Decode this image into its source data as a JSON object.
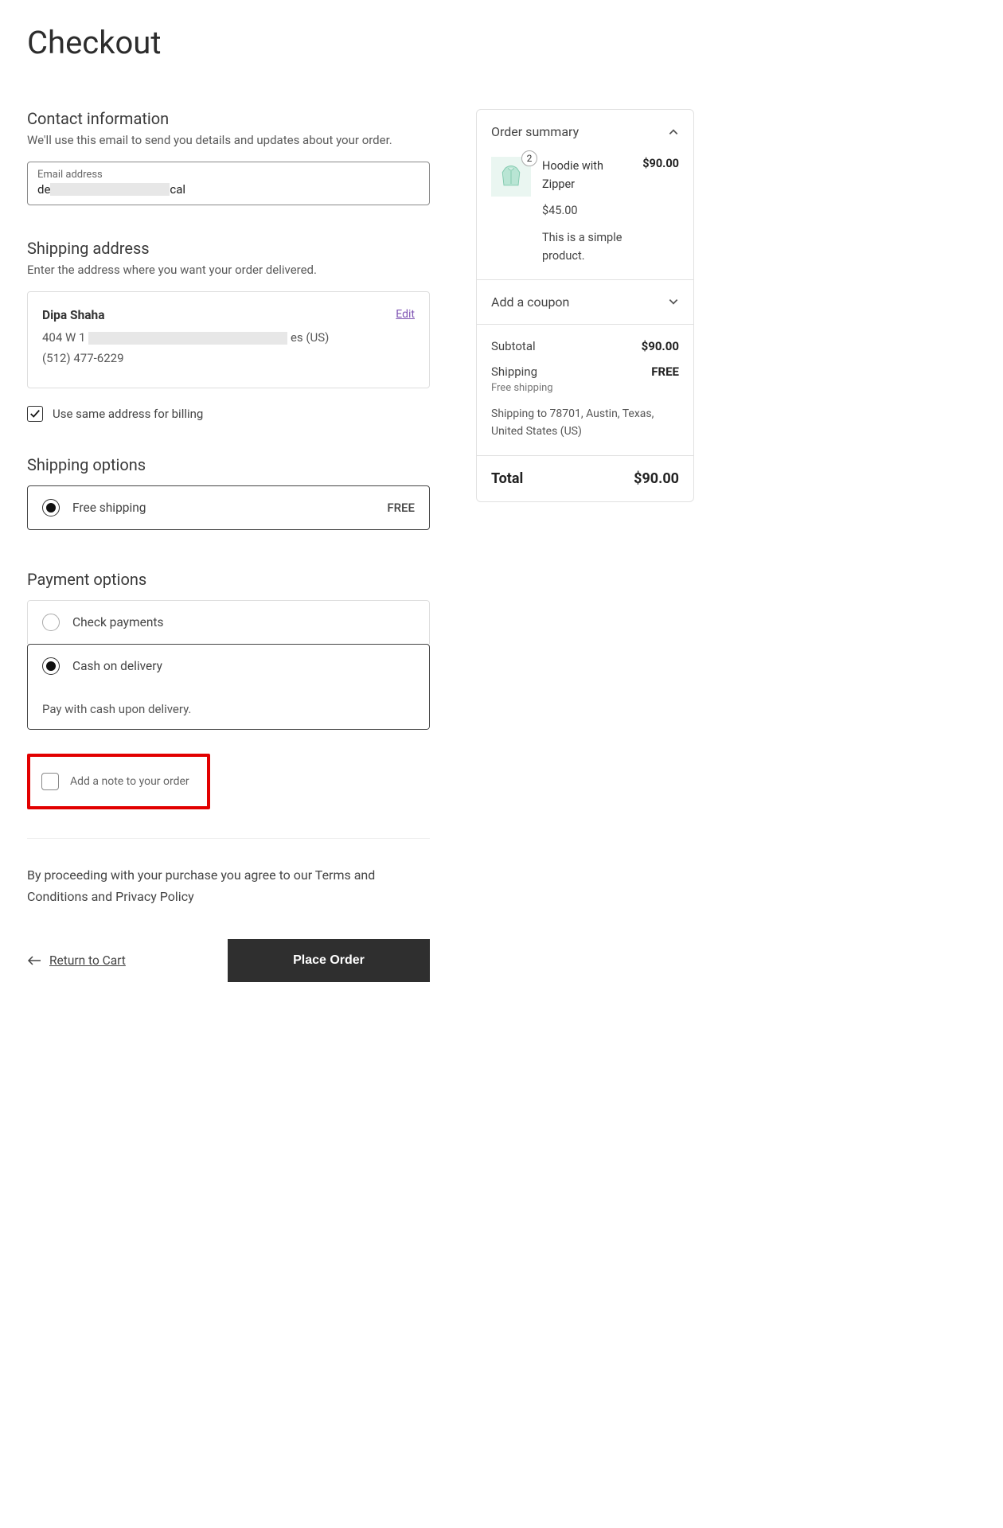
{
  "page_title": "Checkout",
  "contact": {
    "heading": "Contact information",
    "desc": "We'll use this email to send you details and updates about your order.",
    "email_label": "Email address",
    "email_value_prefix": "de",
    "email_value_suffix": "cal"
  },
  "shipping_address": {
    "heading": "Shipping address",
    "desc": "Enter the address where you want your order delivered.",
    "name": "Dipa Shaha",
    "line1_prefix": "404 W 1",
    "line1_suffix": "es (US)",
    "phone": "(512) 477-6229",
    "edit_label": "Edit"
  },
  "billing_checkbox_label": "Use same address for billing",
  "shipping_options": {
    "heading": "Shipping options",
    "options": [
      {
        "label": "Free shipping",
        "price": "FREE",
        "selected": true
      }
    ]
  },
  "payment_options": {
    "heading": "Payment options",
    "options": [
      {
        "label": "Check payments",
        "selected": false
      },
      {
        "label": "Cash on delivery",
        "selected": true,
        "desc": "Pay with cash upon delivery."
      }
    ]
  },
  "order_note_label": "Add a note to your order",
  "terms_text": "By proceeding with your purchase you agree to our Terms and Conditions and Privacy Policy",
  "return_link": "Return to Cart",
  "place_order_label": "Place Order",
  "summary": {
    "title": "Order summary",
    "item": {
      "name": "Hoodie with Zipper",
      "qty": "2",
      "unit_price": "$45.00",
      "line_total": "$90.00",
      "desc": "This is a simple product."
    },
    "coupon_label": "Add a coupon",
    "subtotal_label": "Subtotal",
    "subtotal_value": "$90.00",
    "shipping_label": "Shipping",
    "shipping_value": "FREE",
    "shipping_method": "Free shipping",
    "shipping_dest": "Shipping to 78701, Austin, Texas, United States (US)",
    "total_label": "Total",
    "total_value": "$90.00"
  }
}
